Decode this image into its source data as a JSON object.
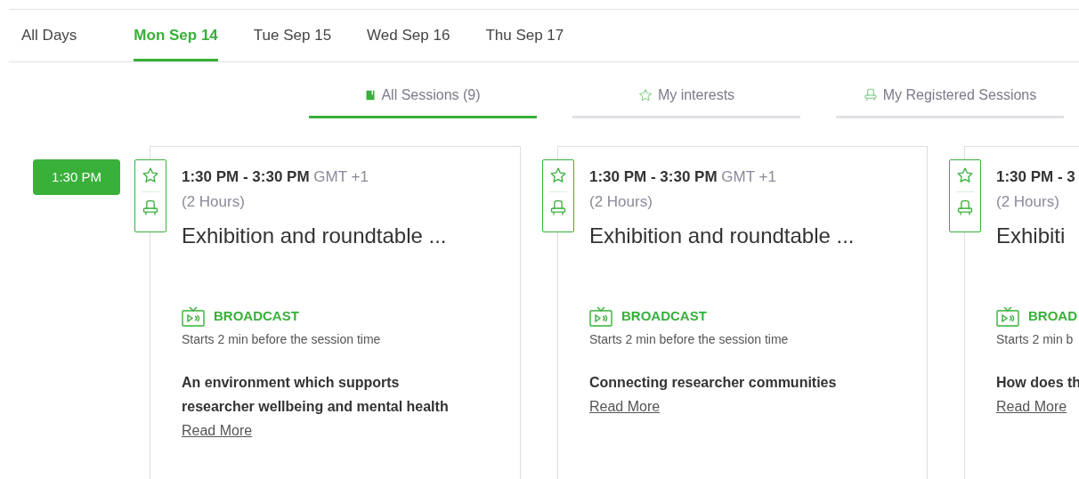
{
  "day_tabs": [
    {
      "label": "All Days",
      "selected": false
    },
    {
      "label": "Mon Sep 14",
      "selected": true
    },
    {
      "label": "Tue Sep 15",
      "selected": false
    },
    {
      "label": "Wed Sep 16",
      "selected": false
    },
    {
      "label": "Thu Sep 17",
      "selected": false
    }
  ],
  "session_tabs": [
    {
      "label": "All Sessions (9)",
      "kind": "book",
      "selected": true
    },
    {
      "label": "My interests",
      "kind": "star",
      "selected": false
    },
    {
      "label": "My Registered Sessions",
      "kind": "seat",
      "selected": false
    }
  ],
  "time_slot": "1:30 PM",
  "sessions": [
    {
      "time": "1:30 PM - 3:30 PM",
      "timezone": "GMT +1",
      "duration": "(2 Hours)",
      "title": "Exhibition and roundtable ...",
      "type": "BROADCAST",
      "note": "Starts 2 min before the session time",
      "summary": "An environment which supports researcher wellbeing and mental health",
      "read_more": "Read More"
    },
    {
      "time": "1:30 PM - 3:30 PM",
      "timezone": "GMT +1",
      "duration": "(2 Hours)",
      "title": "Exhibition and roundtable ...",
      "type": "BROADCAST",
      "note": "Starts 2 min before the session time",
      "summary": "Connecting researcher communities",
      "read_more": "Read More"
    },
    {
      "time": "1:30 PM - 3",
      "duration": "(2 Hours)",
      "title": "Exhibiti",
      "type": "BROAD",
      "note": "Starts 2 min b",
      "summary": "How does th",
      "read_more": "Read More"
    }
  ]
}
